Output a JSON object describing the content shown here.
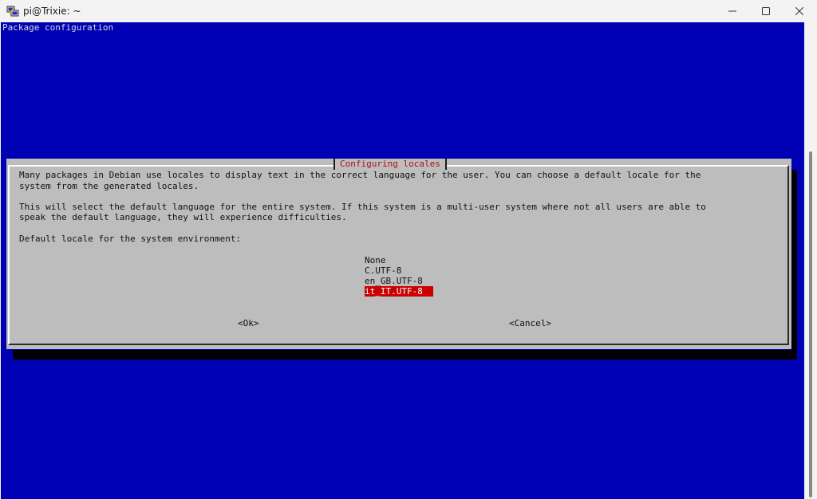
{
  "window": {
    "title": "pi@Trixie: ~",
    "icon": "putty-icon",
    "controls": [
      "minimize-icon",
      "maximize-icon",
      "close-icon"
    ]
  },
  "terminal": {
    "background": "#0000b4",
    "header": "Package configuration"
  },
  "dialog": {
    "title": "Configuring locales",
    "paragraph1_line1": "Many packages in Debian use locales to display text in the correct language for the user. You can choose a default locale for the",
    "paragraph1_line2": "system from the generated locales.",
    "paragraph2_line1": "This will select the default language for the entire system. If this system is a multi-user system where not all users are able to",
    "paragraph2_line2": "speak the default language, they will experience difficulties.",
    "prompt": "Default locale for the system environment:",
    "options": [
      "None",
      "C.UTF-8",
      "en_GB.UTF-8",
      "it_IT.UTF-8"
    ],
    "selected_option": "it_IT.UTF-8",
    "ok_label": "<Ok>",
    "cancel_label": "<Cancel>",
    "highlight_color": "#c80000"
  }
}
